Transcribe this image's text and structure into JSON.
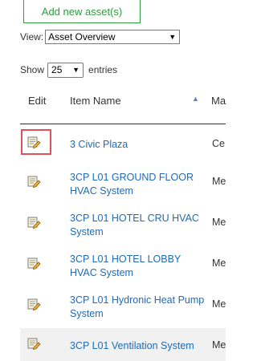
{
  "toolbar": {
    "add_label": "Add new asset(s)"
  },
  "view": {
    "label": "View:",
    "selected": "Asset Overview"
  },
  "paging": {
    "show_label": "Show",
    "entries_value": "25",
    "entries_label": "entries"
  },
  "table": {
    "headers": {
      "edit": "Edit",
      "name": "Item Name",
      "next": "Ma"
    },
    "rows": [
      {
        "name": "3 Civic Plaza",
        "next": "Ce"
      },
      {
        "name": "3CP L01 GROUND FLOOR HVAC System",
        "next": "Me"
      },
      {
        "name": "3CP L01 HOTEL CRU HVAC System",
        "next": "Me"
      },
      {
        "name": "3CP L01 HOTEL LOBBY HVAC System",
        "next": "Me"
      },
      {
        "name": "3CP L01 Hydronic Heat Pump System",
        "next": "Me"
      },
      {
        "name": "3CP L01 Ventilation System",
        "next": "Me"
      }
    ]
  },
  "icons": {
    "edit": "edit-pencil-icon",
    "sort": "sort-asc-icon",
    "caret": "chevron-down-icon"
  },
  "colors": {
    "accent_green": "#2e9c3e",
    "link_blue": "#1f6bb5",
    "highlight_red": "#e0505b"
  }
}
